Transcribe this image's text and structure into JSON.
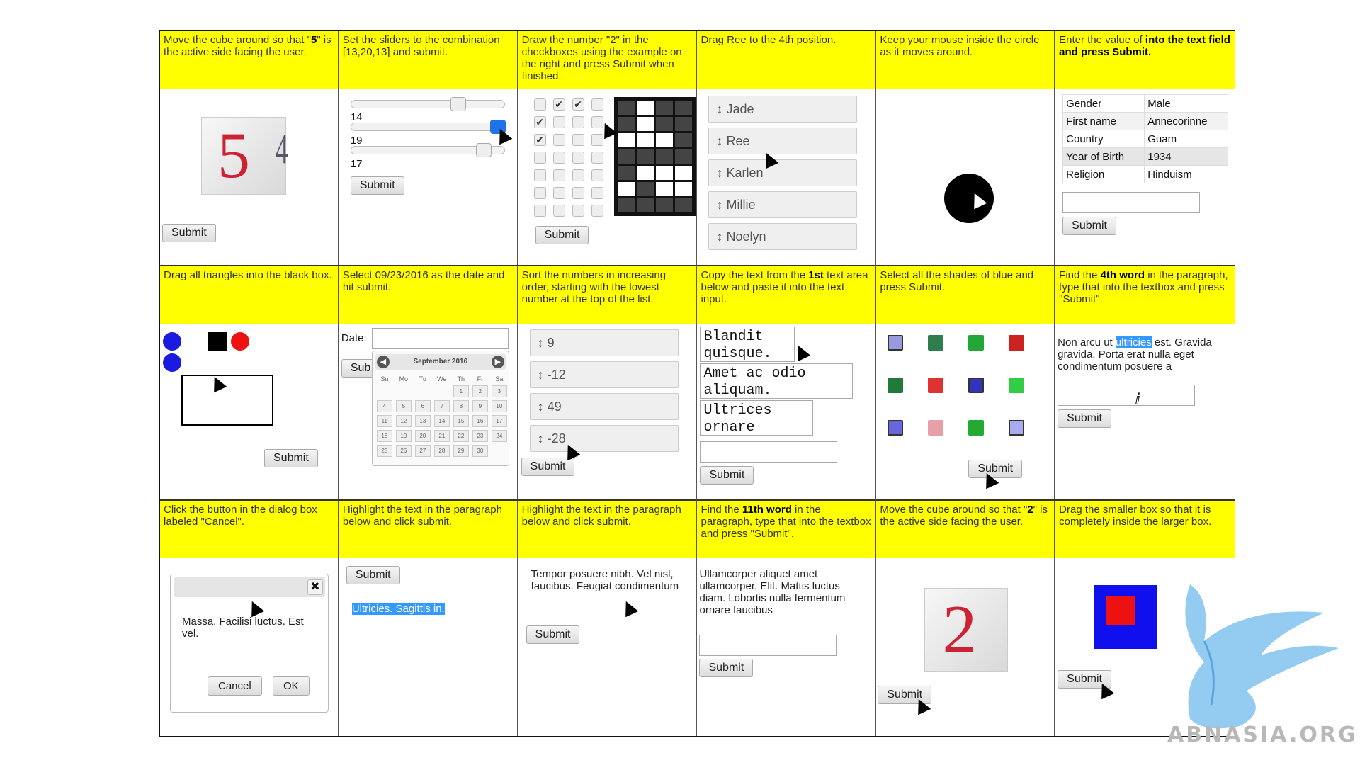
{
  "tasks": {
    "cube5": {
      "instruction_pre": "Move the cube around so that \"",
      "instruction_bold": "5",
      "instruction_post": "\" is the active side facing the user.",
      "front": "5",
      "side": "4",
      "submit": "Submit"
    },
    "sliders": {
      "instruction": "Set the sliders to the combination [13,20,13] and submit.",
      "values": [
        "14",
        "19",
        "17"
      ],
      "submit": "Submit"
    },
    "draw2": {
      "instruction": "Draw the number \"2\" in the checkboxes using the example on the right and press Submit when finished.",
      "submit": "Submit"
    },
    "drag_ree": {
      "instruction": "Drag Ree to the 4th position.",
      "items": [
        "Jade",
        "Ree",
        "Karlen",
        "Millie",
        "Noelyn"
      ]
    },
    "circle": {
      "instruction": "Keep your mouse inside the circle as it moves around."
    },
    "country": {
      "instruction_pre": "Enter the value of ",
      "instruction_bold": "Country",
      "instruction_post": " into the text field and press Submit.",
      "rows": [
        [
          "Gender",
          "Male"
        ],
        [
          "First name",
          "Annecorinne"
        ],
        [
          "Country",
          "Guam"
        ],
        [
          "Year of Birth",
          "1934"
        ],
        [
          "Religion",
          "Hinduism"
        ]
      ],
      "submit": "Submit"
    },
    "triangles": {
      "instruction": "Drag all triangles into the black box.",
      "submit": "Submit"
    },
    "date": {
      "instruction": "Select 09/23/2016 as the date and hit submit.",
      "label": "Date:",
      "submit": "Sub",
      "month": "September 2016",
      "weekdays": [
        "Su",
        "Mo",
        "Tu",
        "We",
        "Th",
        "Fr",
        "Sa"
      ],
      "days": [
        "",
        "",
        "",
        "",
        "1",
        "2",
        "3",
        "4",
        "5",
        "6",
        "7",
        "8",
        "9",
        "10",
        "11",
        "12",
        "13",
        "14",
        "15",
        "16",
        "17",
        "18",
        "19",
        "20",
        "21",
        "22",
        "23",
        "24",
        "25",
        "26",
        "27",
        "28",
        "29",
        "30",
        ""
      ]
    },
    "sortnum": {
      "instruction": "Sort the numbers in increasing order, starting with the lowest number at the top of the list.",
      "items": [
        "9",
        "-12",
        "49",
        "-28"
      ],
      "submit": "Submit"
    },
    "copytext": {
      "instruction_pre": "Copy the text from the ",
      "instruction_bold": "1st",
      "instruction_post": " text area below and paste it into the text input.",
      "areas": [
        [
          "Blandit",
          "quisque."
        ],
        [
          "Amet ac odio",
          "aliquam."
        ],
        [
          "Ultrices",
          "ornare"
        ]
      ],
      "submit": "Submit"
    },
    "blue": {
      "instruction": "Select all the shades of blue and press Submit.",
      "submit": "Submit",
      "colors": [
        "#9999dd",
        "#2e7d4f",
        "#22a63a",
        "#cc2222",
        "#227a3a",
        "#dd3333",
        "#3333bb",
        "#33cc44",
        "#6666dd",
        "#e8a0a8",
        "#22aa33",
        "#aaaaee"
      ]
    },
    "word4": {
      "instruction_pre": "Find the ",
      "instruction_bold": "4th word",
      "instruction_post": " in the paragraph, type that into the textbox and press \"Submit\".",
      "para_pre": "Non arcu ut ",
      "para_hl": "ultricies",
      "para_post": " est. Gravida gravida. Porta erat nulla eget condimentum posuere a",
      "submit": "Submit"
    },
    "cancel": {
      "instruction": "Click the button in the dialog box labeled \"Cancel\".",
      "message": "Massa. Facilisi luctus. Est vel.",
      "cancel": "Cancel",
      "ok": "OK"
    },
    "highlight1": {
      "instruction": "Highlight the text in the paragraph below and click submit.",
      "text": "Ultricies. Sagittis in.",
      "submit": "Submit"
    },
    "highlight2": {
      "instruction": "Highlight the text in the paragraph below and click submit.",
      "text": "Tempor posuere nibh. Vel nisl, faucibus. Feugiat condimentum",
      "submit": "Submit"
    },
    "word11": {
      "instruction_pre": "Find the ",
      "instruction_bold": "11th word",
      "instruction_post": " in the paragraph, type that into the textbox and press \"Submit\".",
      "para": "Ullamcorper aliquet amet ullamcorper. Elit. Mattis luctus diam. Lobortis nulla fermentum ornare faucibus",
      "submit": "Submit"
    },
    "cube2": {
      "instruction_pre": "Move the cube around so that \"",
      "instruction_bold": "2",
      "instruction_post": "\" is the active side facing the user.",
      "front": "2",
      "submit": "Submit"
    },
    "smallbox": {
      "instruction": "Drag the smaller box so that it is completely inside the larger box.",
      "submit": "Submit"
    }
  },
  "watermark": {
    "text": "ABNASIA.ORG"
  },
  "colors": {
    "instruction_bg": "#ffff00",
    "highlight": "#3399ff",
    "cube_number": "#cc2233",
    "big_box": "#1010ee",
    "small_box": "#ee1111"
  }
}
